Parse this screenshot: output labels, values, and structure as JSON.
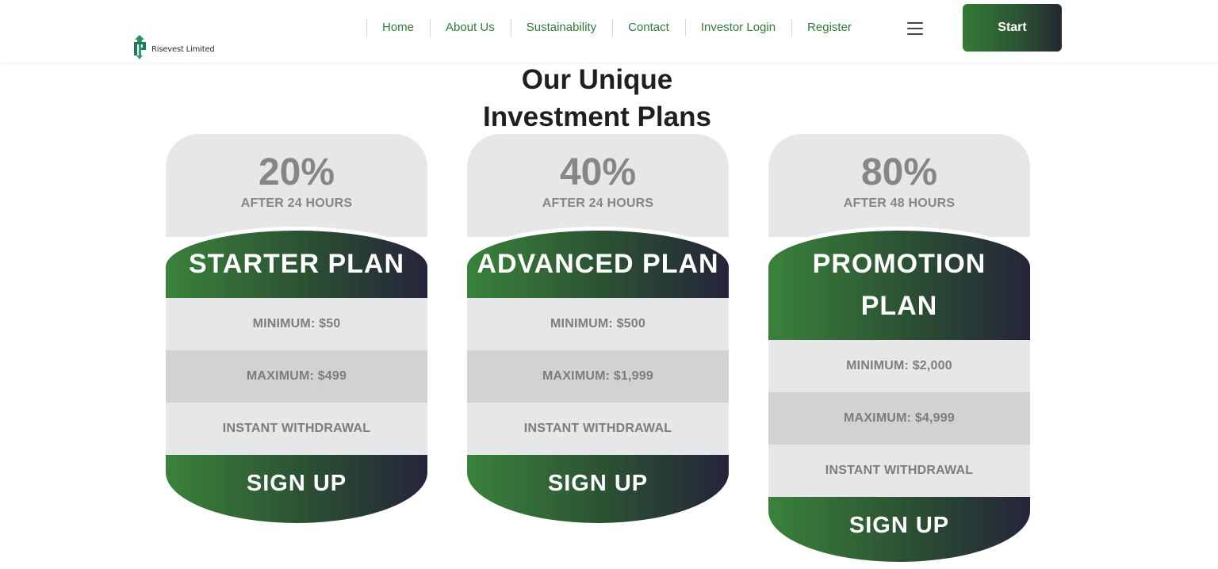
{
  "brand": {
    "name": "Risevest Limited"
  },
  "nav": {
    "items": [
      {
        "label": "Home"
      },
      {
        "label": "About Us"
      },
      {
        "label": "Sustainability"
      },
      {
        "label": "Contact"
      },
      {
        "label": "Investor Login"
      },
      {
        "label": "Register"
      }
    ],
    "start_label": "Start",
    "menu_icon": "hamburger-icon"
  },
  "section": {
    "title_line1": "Our Unique",
    "title_line2": "Investment Plans"
  },
  "colors": {
    "accent_green": "#2f7d32",
    "gradient_start": "#3a823b",
    "gradient_end": "#24243a",
    "card_bg": "#e6e7e8",
    "card_row_dark": "#d1d2d3"
  },
  "plans": [
    {
      "rate": "20%",
      "period": "AFTER 24 HOURS",
      "name": "STARTER PLAN",
      "minimum": "MINIMUM: $50",
      "maximum": "MAXIMUM: $499",
      "withdrawal": "INSTANT WITHDRAWAL",
      "cta": "SIGN UP"
    },
    {
      "rate": "40%",
      "period": "AFTER 24 HOURS",
      "name": "ADVANCED PLAN",
      "minimum": "MINIMUM: $500",
      "maximum": "MAXIMUM: $1,999",
      "withdrawal": "INSTANT WITHDRAWAL",
      "cta": "SIGN UP"
    },
    {
      "rate": "80%",
      "period": "AFTER 48 HOURS",
      "name_line1": "PROMOTION",
      "name_line2": "PLAN",
      "minimum": "MINIMUM: $2,000",
      "maximum": "MAXIMUM: $4,999",
      "withdrawal": "INSTANT WITHDRAWAL",
      "cta": "SIGN UP"
    }
  ]
}
